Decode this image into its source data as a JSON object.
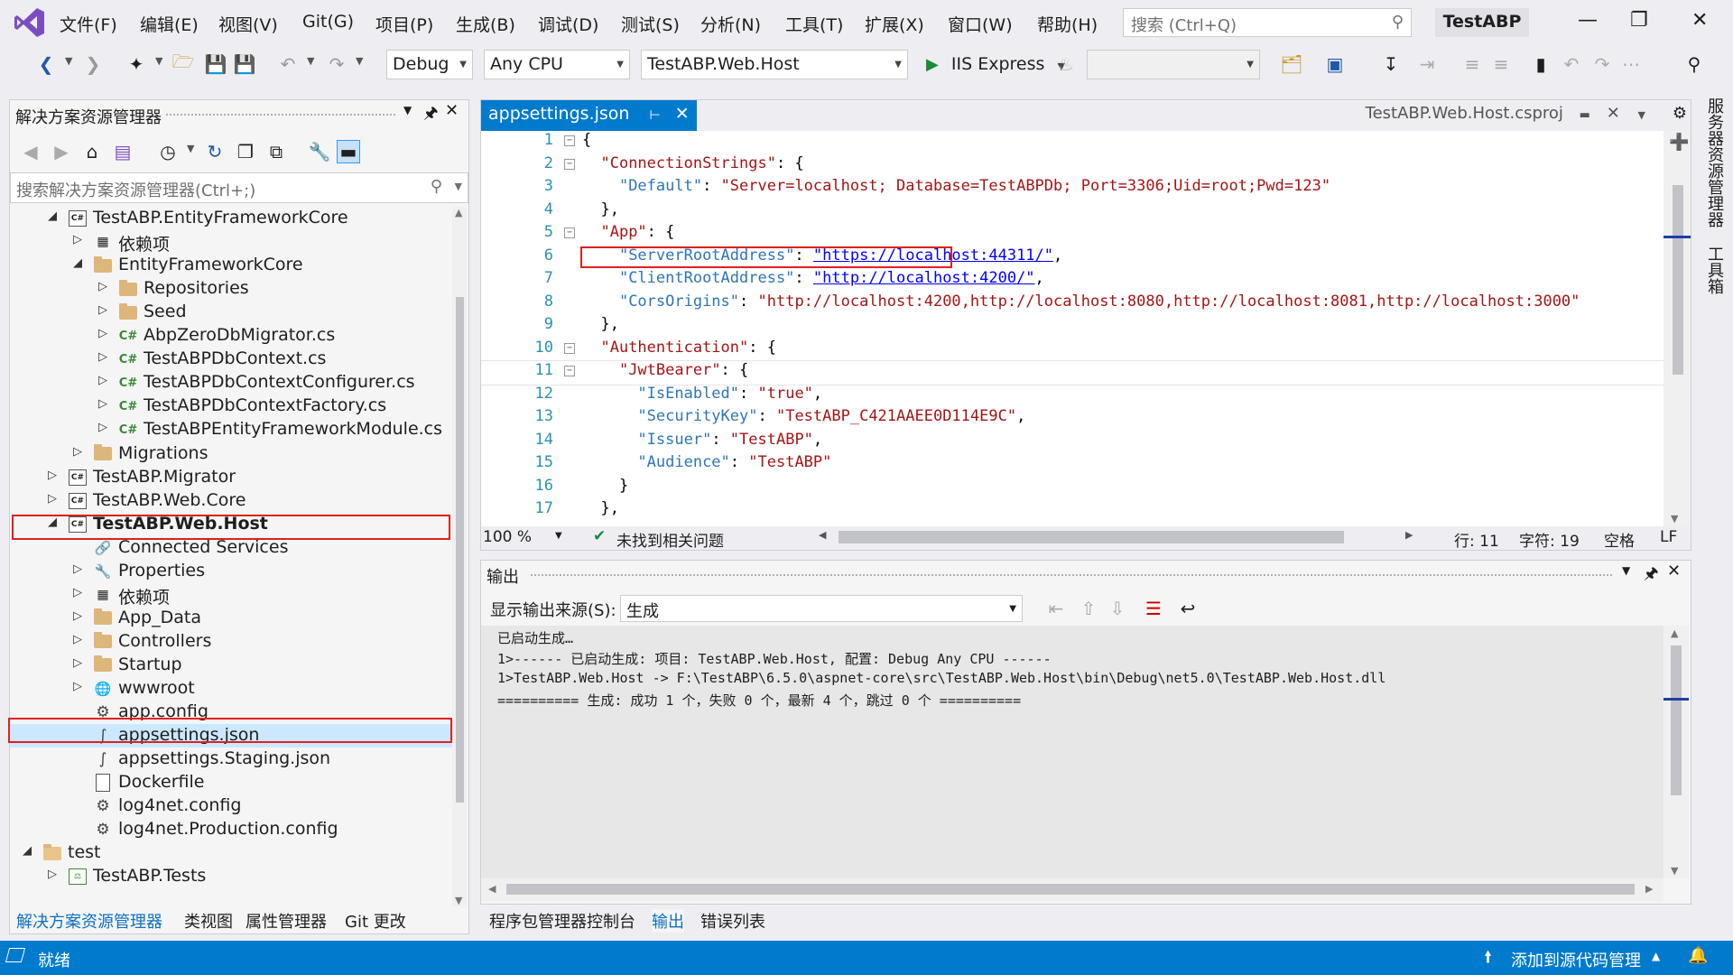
{
  "menu": {
    "items": [
      "文件(F)",
      "编辑(E)",
      "视图(V)",
      "Git(G)",
      "项目(P)",
      "生成(B)",
      "调试(D)",
      "测试(S)",
      "分析(N)",
      "工具(T)",
      "扩展(X)",
      "窗口(W)",
      "帮助(H)"
    ],
    "search_placeholder": "搜索 (Ctrl+Q)",
    "solution_name": "TestABP"
  },
  "toolbar": {
    "configuration": "Debug",
    "platform": "Any CPU",
    "startup_project": "TestABP.Web.Host",
    "run_label": "IIS Express"
  },
  "solution_explorer": {
    "title": "解决方案资源管理器",
    "search_placeholder": "搜索解决方案资源管理器(Ctrl+;)",
    "tree": [
      {
        "label": "TestABP.EntityFrameworkCore",
        "icon": "csproj-icon",
        "depth": 1,
        "expander": "expanded"
      },
      {
        "label": "依赖项",
        "icon": "dependencies-icon",
        "depth": 2,
        "expander": "collapsed"
      },
      {
        "label": "EntityFrameworkCore",
        "icon": "folder-icon",
        "depth": 2,
        "expander": "expanded"
      },
      {
        "label": "Repositories",
        "icon": "folder-icon",
        "depth": 3,
        "expander": "collapsed"
      },
      {
        "label": "Seed",
        "icon": "folder-icon",
        "depth": 3,
        "expander": "collapsed"
      },
      {
        "label": "AbpZeroDbMigrator.cs",
        "icon": "csharp-file-icon",
        "depth": 3,
        "expander": "collapsed"
      },
      {
        "label": "TestABPDbContext.cs",
        "icon": "csharp-file-icon",
        "depth": 3,
        "expander": "collapsed"
      },
      {
        "label": "TestABPDbContextConfigurer.cs",
        "icon": "csharp-file-icon",
        "depth": 3,
        "expander": "collapsed"
      },
      {
        "label": "TestABPDbContextFactory.cs",
        "icon": "csharp-file-icon",
        "depth": 3,
        "expander": "collapsed"
      },
      {
        "label": "TestABPEntityFrameworkModule.cs",
        "icon": "csharp-file-icon",
        "depth": 3,
        "expander": "collapsed"
      },
      {
        "label": "Migrations",
        "icon": "folder-icon",
        "depth": 2,
        "expander": "collapsed"
      },
      {
        "label": "TestABP.Migrator",
        "icon": "csproj-icon",
        "depth": 1,
        "expander": "collapsed"
      },
      {
        "label": "TestABP.Web.Core",
        "icon": "csproj-icon",
        "depth": 1,
        "expander": "collapsed"
      },
      {
        "label": "TestABP.Web.Host",
        "icon": "csproj-icon",
        "depth": 1,
        "expander": "expanded",
        "bold": true
      },
      {
        "label": "Connected Services",
        "icon": "connected-services-icon",
        "depth": 2,
        "expander": "none"
      },
      {
        "label": "Properties",
        "icon": "properties-icon",
        "depth": 2,
        "expander": "collapsed"
      },
      {
        "label": "依赖项",
        "icon": "dependencies-icon",
        "depth": 2,
        "expander": "collapsed"
      },
      {
        "label": "App_Data",
        "icon": "folder-icon",
        "depth": 2,
        "expander": "collapsed"
      },
      {
        "label": "Controllers",
        "icon": "folder-icon",
        "depth": 2,
        "expander": "collapsed"
      },
      {
        "label": "Startup",
        "icon": "folder-icon",
        "depth": 2,
        "expander": "collapsed"
      },
      {
        "label": "wwwroot",
        "icon": "globe-icon",
        "depth": 2,
        "expander": "collapsed"
      },
      {
        "label": "app.config",
        "icon": "config-file-icon",
        "depth": 2,
        "expander": "none"
      },
      {
        "label": "appsettings.json",
        "icon": "json-file-icon",
        "depth": 2,
        "expander": "none",
        "selected": true
      },
      {
        "label": "appsettings.Staging.json",
        "icon": "json-file-icon",
        "depth": 2,
        "expander": "none"
      },
      {
        "label": "Dockerfile",
        "icon": "file-icon",
        "depth": 2,
        "expander": "none"
      },
      {
        "label": "log4net.config",
        "icon": "config-file-icon",
        "depth": 2,
        "expander": "none"
      },
      {
        "label": "log4net.Production.config",
        "icon": "config-file-icon",
        "depth": 2,
        "expander": "none"
      },
      {
        "label": "test",
        "icon": "folder-open-icon",
        "depth": 0,
        "expander": "expanded"
      },
      {
        "label": "TestABP.Tests",
        "icon": "test-project-icon",
        "depth": 1,
        "expander": "collapsed"
      }
    ],
    "bottom_tabs": [
      "解决方案资源管理器",
      "类视图",
      "属性管理器",
      "Git 更改"
    ]
  },
  "editor": {
    "active_tab": "appsettings.json",
    "right_tab": "TestABP.Web.Host.csproj",
    "lines": [
      {
        "n": "1",
        "fold": "−",
        "html": "{"
      },
      {
        "n": "2",
        "fold": "−",
        "html": "  <span class='s'>\"ConnectionStrings\"</span>: {"
      },
      {
        "n": "3",
        "fold": "",
        "html": "    <span class='k'>\"Default\"</span>: <span class='s'>\"Server=localhost; Database=TestABPDb; Port=3306;Uid=root;Pwd=123\"</span>"
      },
      {
        "n": "4",
        "fold": "",
        "html": "  },"
      },
      {
        "n": "5",
        "fold": "−",
        "html": "  <span class='s'>\"App\"</span>: {"
      },
      {
        "n": "6",
        "fold": "",
        "html": "    <span class='k'>\"ServerRootAddress\"</span>: <span class='u'>\"https://localhost:44311/\"</span>,"
      },
      {
        "n": "7",
        "fold": "",
        "html": "    <span class='k'>\"ClientRootAddress\"</span>: <span class='u'>\"http://localhost:4200/\"</span>,"
      },
      {
        "n": "8",
        "fold": "",
        "html": "    <span class='k'>\"CorsOrigins\"</span>: <span class='s'>\"http://localhost:4200,http://localhost:8080,http://localhost:8081,http://localhost:3000\"</span>"
      },
      {
        "n": "9",
        "fold": "",
        "html": "  },"
      },
      {
        "n": "10",
        "fold": "−",
        "html": "  <span class='s'>\"Authentication\"</span>: {"
      },
      {
        "n": "11",
        "fold": "−",
        "html": "    <span class='s'>\"JwtBearer\"</span>: {",
        "current": true
      },
      {
        "n": "12",
        "fold": "",
        "html": "      <span class='k'>\"IsEnabled\"</span>: <span class='s'>\"true\"</span>,"
      },
      {
        "n": "13",
        "fold": "",
        "html": "      <span class='k'>\"SecurityKey\"</span>: <span class='s'>\"TestABP_C421AAEE0D114E9C\"</span>,"
      },
      {
        "n": "14",
        "fold": "",
        "html": "      <span class='k'>\"Issuer\"</span>: <span class='s'>\"TestABP\"</span>,"
      },
      {
        "n": "15",
        "fold": "",
        "html": "      <span class='k'>\"Audience\"</span>: <span class='s'>\"TestABP\"</span>"
      },
      {
        "n": "16",
        "fold": "",
        "html": "    }"
      },
      {
        "n": "17",
        "fold": "",
        "html": "  },"
      }
    ],
    "zoom": "100 %",
    "issues": "未找到相关问题",
    "line_info": "行: 11",
    "col_info": "字符: 19",
    "indent": "空格",
    "eol": "LF"
  },
  "output": {
    "title": "输出",
    "source_label": "显示输出来源(S):",
    "source_value": "生成",
    "lines": [
      "已启动生成…",
      "1>------ 已启动生成: 项目: TestABP.Web.Host, 配置: Debug Any CPU ------",
      "1>TestABP.Web.Host -> F:\\TestABP\\6.5.0\\aspnet-core\\src\\TestABP.Web.Host\\bin\\Debug\\net5.0\\TestABP.Web.Host.dll",
      "========== 生成: 成功 1 个，失败 0 个，最新 4 个，跳过 0 个 =========="
    ],
    "bottom_tabs": [
      "程序包管理器控制台",
      "输出",
      "错误列表"
    ]
  },
  "right_rail": {
    "items": [
      "服务器资源管理器",
      "工具箱"
    ]
  },
  "statusbar": {
    "ready": "就绪",
    "source_control": "添加到源代码管理"
  },
  "colors": {
    "accent": "#007acc",
    "highlight": "#e02020",
    "selection": "#cce8ff"
  }
}
